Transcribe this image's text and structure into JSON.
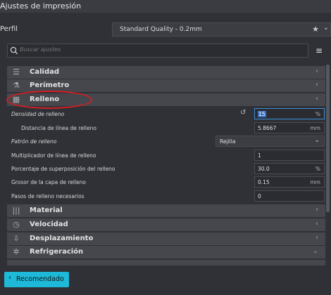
{
  "window": {
    "title": "Ajustes de impresión"
  },
  "profile": {
    "label": "Perfil",
    "value": "Standard Quality - 0.2mm"
  },
  "search": {
    "placeholder": "Buscar ajustes"
  },
  "categories": {
    "calidad": "Calidad",
    "perimetro": "Perímetro",
    "relleno": "Relleno",
    "material": "Material",
    "velocidad": "Velocidad",
    "desplazamiento": "Desplazamiento",
    "refrigeracion": "Refrigeración"
  },
  "settings": {
    "densidad": {
      "label": "Densidad de relleno",
      "value": "15",
      "unit": "%"
    },
    "distancia": {
      "label": "Distancia de línea de relleno",
      "value": "5.8667",
      "unit": "mm"
    },
    "patron": {
      "label": "Patrón de relleno",
      "value": "Rejilla"
    },
    "multiplicador": {
      "label": "Multiplicador de línea de relleno",
      "value": "1"
    },
    "superposicion": {
      "label": "Porcentaje de superposición del relleno",
      "value": "30.0",
      "unit": "%"
    },
    "grosor": {
      "label": "Grosor de la capa de relleno",
      "value": "0.15",
      "unit": "mm"
    },
    "pasos": {
      "label": "Pasos de relleno necesarios",
      "value": "0"
    }
  },
  "footer": {
    "recommended_label": "Recomendado"
  },
  "colors": {
    "accent": "#1eb8d8",
    "highlight_ring": "#d21f25",
    "category_bg": "#45474d",
    "background": "#2f3136"
  }
}
